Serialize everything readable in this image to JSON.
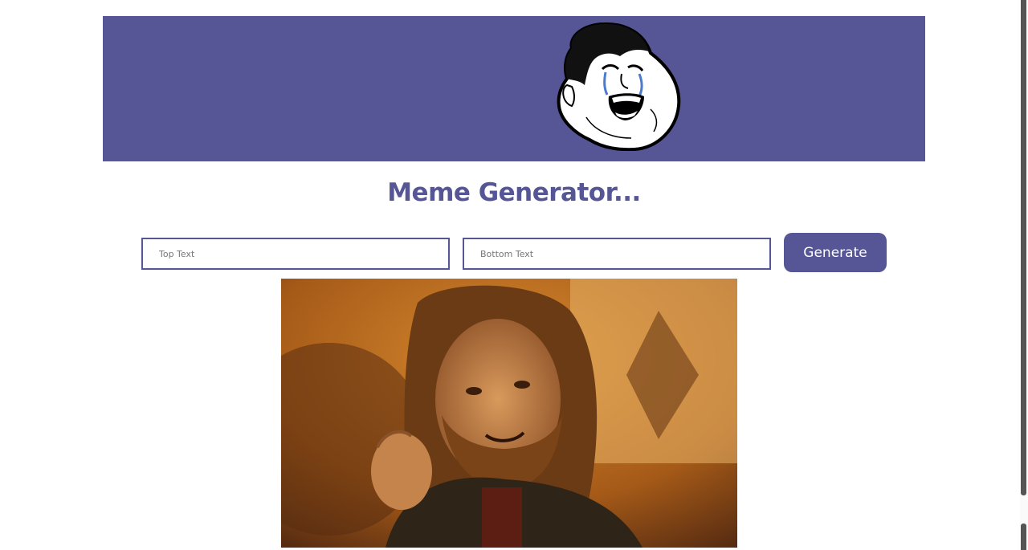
{
  "header": {
    "logo_icon": "crying-laughing-meme-face-icon",
    "background_color": "#565595"
  },
  "title": "Meme Generator...",
  "form": {
    "top_placeholder": "Top Text",
    "bottom_placeholder": "Bottom Text",
    "generate_label": "Generate"
  },
  "meme": {
    "image_icon": "one-does-not-simply-meme-image"
  },
  "colors": {
    "accent": "#565595",
    "background": "#ffffff"
  }
}
